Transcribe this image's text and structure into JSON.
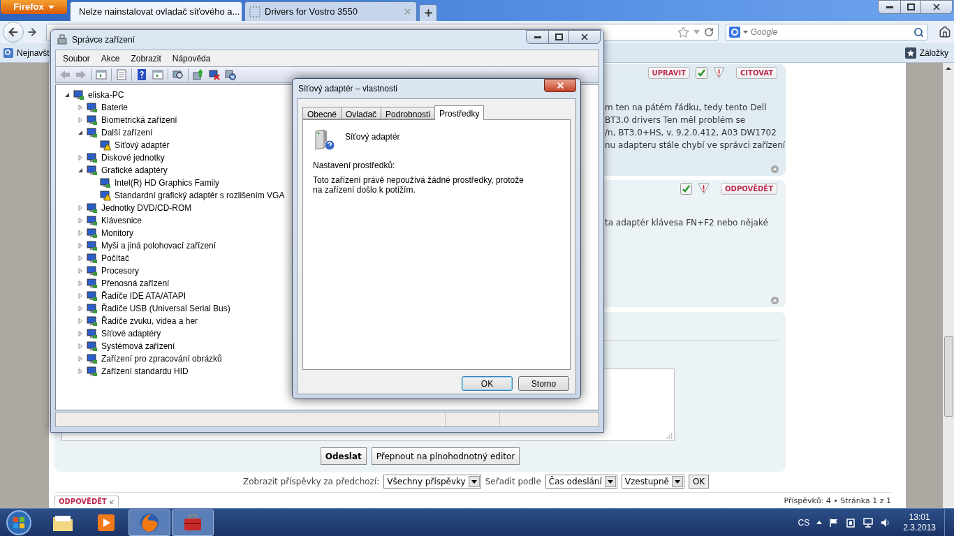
{
  "browser": {
    "menu_button": "Firefox",
    "tabs": [
      {
        "title": "Nelze nainstalovat ovladač síťového a...",
        "selected": true
      },
      {
        "title": "Drivers for Vostro 3550",
        "selected": false
      }
    ],
    "search": {
      "placeholder": "Google"
    },
    "bookmarks": {
      "left": "Nejnavšt",
      "right": "Záložky"
    }
  },
  "forum": {
    "posts": [
      {
        "actions": [
          {
            "kind": "button",
            "label": "UPRAVIT"
          },
          {
            "kind": "approve"
          },
          {
            "kind": "report"
          },
          {
            "kind": "button",
            "label": "CITOVAT"
          }
        ],
        "lines": [
          "m ten na pátém řádku, tedy tento Dell",
          "BT3.0 drivers Ten měl problém se",
          "/n, BT3.0+HS, v. 9.2.0.412, A03 DW1702",
          "nu adapteru stále chybí ve správci zařízení"
        ]
      },
      {
        "actions": [
          {
            "kind": "approve"
          },
          {
            "kind": "report"
          },
          {
            "kind": "button",
            "label": "ODPOVĚDĚT"
          }
        ],
        "lines": [
          "ta adaptér klávesa FN+F2 nebo nějaké"
        ]
      }
    ],
    "reply_form": {
      "buttons": [
        {
          "label": "Odeslat",
          "primary": true
        },
        {
          "label": "Přepnout na plnohodnotný editor",
          "primary": false
        }
      ]
    },
    "sort_bar": {
      "show_label": "Zobrazit příspěvky za předchozí:",
      "show_value": "Všechny příspěvky",
      "sort_label": "Seřadit podle",
      "sort_value": "Čas odeslání",
      "order_value": "Vzestupně",
      "ok": "OK"
    },
    "footer": {
      "reply_button": "ODPOVĚDĚT",
      "pagination": "Příspěvků: 4 • Stránka 1 z 1"
    }
  },
  "device_manager": {
    "title": "Správce zařízení",
    "menu": [
      "Soubor",
      "Akce",
      "Zobrazit",
      "Nápověda"
    ],
    "tree": [
      {
        "label": "eliska-PC",
        "expanded": true,
        "children": [
          {
            "label": "Baterie",
            "expanded": false
          },
          {
            "label": "Biometrická zařízení",
            "expanded": false
          },
          {
            "label": "Další zařízení",
            "expanded": true,
            "children": [
              {
                "label": "Síťový adaptér",
                "warning": true
              }
            ]
          },
          {
            "label": "Diskové jednotky",
            "expanded": false
          },
          {
            "label": "Grafické adaptéry",
            "expanded": true,
            "children": [
              {
                "label": "Intel(R) HD Graphics Family",
                "warning": false
              },
              {
                "label": "Standardní grafický adaptér s rozlišením VGA",
                "warning": true
              }
            ]
          },
          {
            "label": "Jednotky DVD/CD-ROM",
            "expanded": false
          },
          {
            "label": "Klávesnice",
            "expanded": false
          },
          {
            "label": "Monitory",
            "expanded": false
          },
          {
            "label": "Myši a jiná polohovací zařízení",
            "expanded": false
          },
          {
            "label": "Počítač",
            "expanded": false
          },
          {
            "label": "Procesory",
            "expanded": false
          },
          {
            "label": "Přenosná zařízení",
            "expanded": false
          },
          {
            "label": "Řadiče IDE ATA/ATAPI",
            "expanded": false
          },
          {
            "label": "Řadiče USB (Universal Serial Bus)",
            "expanded": false
          },
          {
            "label": "Řadiče zvuku, videa a her",
            "expanded": false
          },
          {
            "label": "Síťové adaptéry",
            "expanded": false
          },
          {
            "label": "Systémová zařízení",
            "expanded": false
          },
          {
            "label": "Zařízení pro zpracování obrázků",
            "expanded": false
          },
          {
            "label": "Zařízení standardu HID",
            "expanded": false
          }
        ]
      }
    ]
  },
  "dialog": {
    "title": "Síťový adaptér – vlastnosti",
    "tabs": [
      {
        "label": "Obecné",
        "selected": false
      },
      {
        "label": "Ovladač",
        "selected": false
      },
      {
        "label": "Podrobnosti",
        "selected": false
      },
      {
        "label": "Prostředky",
        "selected": true
      }
    ],
    "device_name": "Síťový adaptér",
    "settings_label": "Nastavení prostředků:",
    "message": "Toto zařízení právě nepoužívá žádné prostředky, protože na zařízení došlo k potížím.",
    "buttons": [
      {
        "label": "OK",
        "default": true
      },
      {
        "label": "Storno",
        "default": false
      }
    ]
  },
  "taskbar": {
    "apps": [
      {
        "kind": "folder",
        "active": false
      },
      {
        "kind": "media",
        "active": false
      },
      {
        "kind": "browser",
        "active": true
      },
      {
        "kind": "toolbox",
        "active": true
      }
    ],
    "language": "CS",
    "time": "13:01",
    "date": "2.3.2013"
  }
}
